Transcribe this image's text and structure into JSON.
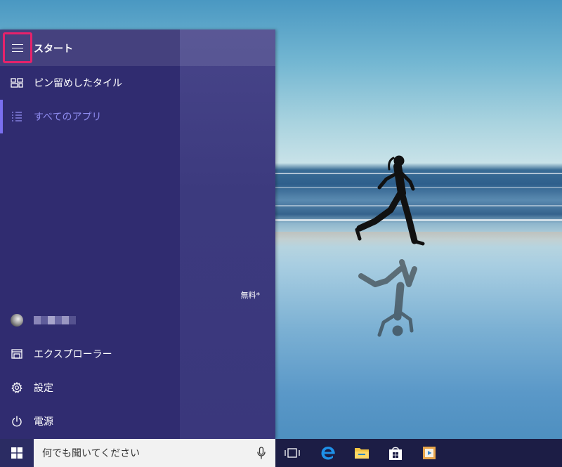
{
  "start_menu": {
    "title": "スタート",
    "nav_items": [
      {
        "label": "ピン留めしたタイル",
        "icon": "pinned-tiles-icon"
      },
      {
        "label": "すべてのアプリ",
        "icon": "all-apps-list-icon",
        "active": true
      }
    ],
    "bottom_items": [
      {
        "label": "エクスプローラー",
        "icon": "file-explorer-icon"
      },
      {
        "label": "設定",
        "icon": "gear-icon"
      },
      {
        "label": "電源",
        "icon": "power-icon"
      }
    ],
    "tile_label": "無料*"
  },
  "taskbar": {
    "search_placeholder": "何でも聞いてください",
    "pinned_apps": [
      "task-view-icon",
      "edge-icon",
      "file-explorer-icon",
      "store-icon",
      "media-player-icon"
    ]
  },
  "colors": {
    "accent": "#7a6ff0",
    "highlight_border": "#e6226b",
    "menu_background": "#302c70",
    "taskbar_background": "#1c1d45"
  }
}
